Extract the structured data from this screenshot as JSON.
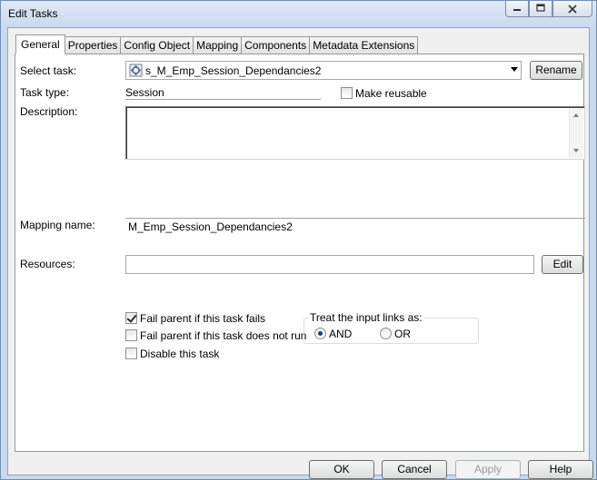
{
  "window": {
    "title": "Edit Tasks",
    "minimize_glyph": "▭",
    "maximize_glyph": "▢",
    "close_glyph": "✕"
  },
  "tabs": [
    {
      "label": "General",
      "active": true
    },
    {
      "label": "Properties"
    },
    {
      "label": "Config Object"
    },
    {
      "label": "Mapping"
    },
    {
      "label": "Components"
    },
    {
      "label": "Metadata Extensions"
    }
  ],
  "general": {
    "select_task_label": "Select task:",
    "select_task_value": "s_M_Emp_Session_Dependancies2",
    "rename_button": "Rename",
    "task_type_label": "Task type:",
    "task_type_value": "Session",
    "make_reusable_label": "Make reusable",
    "make_reusable_checked": false,
    "description_label": "Description:",
    "description_value": "",
    "mapping_name_label": "Mapping name:",
    "mapping_name_value": "M_Emp_Session_Dependancies2",
    "resources_label": "Resources:",
    "resources_value": "",
    "edit_button": "Edit",
    "fail_parent_if_fails_label": "Fail parent if this task fails",
    "fail_parent_if_fails_checked": true,
    "fail_parent_if_not_run_label": "Fail parent if this task does not run",
    "fail_parent_if_not_run_checked": false,
    "disable_task_label": "Disable this task",
    "disable_task_checked": false,
    "input_links_title": "Treat the input links as:",
    "and_label": "AND",
    "or_label": "OR",
    "input_links_value": "AND"
  },
  "footer": {
    "ok": "OK",
    "cancel": "Cancel",
    "apply": "Apply",
    "help": "Help"
  },
  "colors": {
    "window_frame": "#c9d9ee",
    "panel": "#ffffff",
    "face": "#f0f0f0"
  },
  "icons": {
    "task_combo": "session-task-icon"
  }
}
